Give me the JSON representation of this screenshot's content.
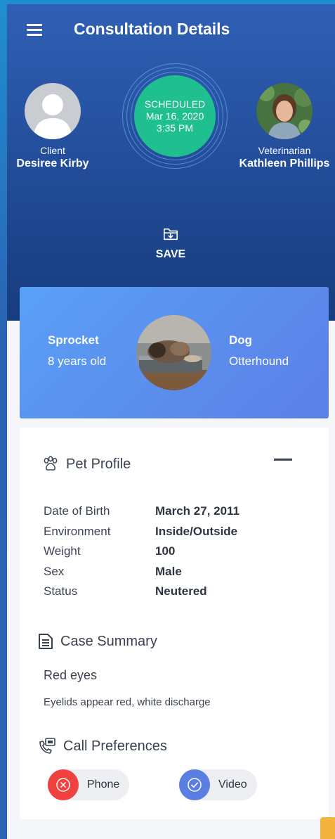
{
  "header": {
    "title": "Consultation Details",
    "menu_icon": "menu-icon"
  },
  "client": {
    "role": "Client",
    "name": "Desiree Kirby"
  },
  "veterinarian": {
    "role": "Veterinarian",
    "name": "Kathleen Phillips"
  },
  "appointment": {
    "status": "SCHEDULED",
    "date": "Mar 16, 2020",
    "time": "3:35 PM",
    "status_color": "#1fbf8f"
  },
  "save": {
    "label": "SAVE",
    "icon": "folder-save-icon"
  },
  "pet": {
    "name": "Sprocket",
    "age": "8 years old",
    "species": "Dog",
    "breed": "Otterhound"
  },
  "pet_profile": {
    "title": "Pet Profile",
    "icon": "paw-icon",
    "fields": [
      {
        "label": "Date of Birth",
        "value": "March 27, 2011"
      },
      {
        "label": "Environment",
        "value": "Inside/Outside"
      },
      {
        "label": "Weight",
        "value": "100"
      },
      {
        "label": "Sex",
        "value": "Male"
      },
      {
        "label": "Status",
        "value": "Neutered"
      }
    ]
  },
  "case_summary": {
    "title": "Case Summary",
    "icon": "document-icon",
    "headline": "Red eyes",
    "description": "Eyelids appear red, white discharge"
  },
  "call_preferences": {
    "title": "Call Preferences",
    "icon": "phone-video-icon",
    "options": [
      {
        "label": "Phone",
        "selected": false,
        "color": "#f0413f"
      },
      {
        "label": "Video",
        "selected": true,
        "color": "#5a7ee2"
      }
    ]
  },
  "colors": {
    "header_top": "#2f5fb5",
    "header_bottom": "#173c7f",
    "pet_card": "#5a90f0",
    "accent_fab": "#f4b33d"
  }
}
